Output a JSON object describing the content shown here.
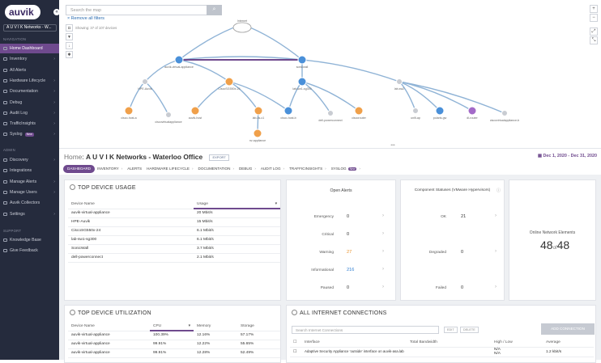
{
  "brand": {
    "logo_text": "auvik",
    "collapse_icon": "«"
  },
  "org_selector": "A U V I K Networks - W...",
  "sidebar": {
    "navigation_label": "NAVIGATION",
    "nav_items": [
      {
        "label": "Home Dashboard",
        "active": true
      },
      {
        "label": "Inventory",
        "chevron": "›"
      },
      {
        "label": "All Alerts"
      },
      {
        "label": "Hardware Lifecycle",
        "chevron": "›"
      },
      {
        "label": "Documentation",
        "chevron": "›"
      },
      {
        "label": "Debug",
        "chevron": "›"
      },
      {
        "label": "Audit Log",
        "chevron": "›"
      },
      {
        "label": "TrafficInsights",
        "chevron": "›"
      },
      {
        "label": "Syslog",
        "badge": "New",
        "chevron": "›"
      }
    ],
    "admin_label": "ADMIN",
    "admin_items": [
      {
        "label": "Discovery",
        "chevron": "›"
      },
      {
        "label": "Integrations"
      },
      {
        "label": "Manage Alerts",
        "chevron": "›"
      },
      {
        "label": "Manage Users",
        "chevron": "›"
      },
      {
        "label": "Auvik Collectors"
      },
      {
        "label": "Settings",
        "chevron": "›"
      }
    ],
    "support_label": "SUPPORT",
    "support_items": [
      {
        "label": "Knowledge Base"
      },
      {
        "label": "Give Feedback"
      }
    ]
  },
  "map": {
    "search_placeholder": "Search the map",
    "remove_filters": "Remove all filters",
    "showing": "Showing: 37 of 107 devices",
    "nodes": [
      "Internet",
      "sonicwall",
      "auvik-virtual-appliance",
      "HPE-Auvik",
      "CiscoSG550x-24",
      "lab-sw1-sg300",
      "cisco-host-a",
      "ciscovirtualappliance",
      "auvik-host",
      "lab-ks-c1",
      "cisco-host-b",
      "dell-powerconnect",
      "ciscorouter",
      "lab-sw2",
      "unifi-ap",
      "polaris-gw",
      "dl-router",
      "ciscovirtualappliance-b",
      "nv-appliance"
    ]
  },
  "header": {
    "home": "Home",
    "title": "A U V I K Networks - Waterloo Office",
    "export": "EXPORT",
    "date_range": "Dec 1, 2020 - Dec 31, 2020",
    "tabs": [
      {
        "label": "DASHBOARD",
        "active": true
      },
      {
        "label": "INVENTORY",
        "chevron": "›"
      },
      {
        "label": "ALERTS"
      },
      {
        "label": "HARDWARE LIFECYCLE",
        "chevron": "›"
      },
      {
        "label": "DOCUMENTATION",
        "chevron": "›"
      },
      {
        "label": "DEBUG",
        "chevron": "›"
      },
      {
        "label": "AUDIT LOG",
        "chevron": "›"
      },
      {
        "label": "TRAFFICINSIGHTS",
        "chevron": "›"
      },
      {
        "label": "SYSLOG",
        "badge": "New",
        "chevron": "›"
      }
    ]
  },
  "top_usage": {
    "title": "TOP DEVICE USAGE",
    "columns": [
      "Device Name",
      "Usage"
    ],
    "rows": [
      [
        "auvik-virtual-appliance",
        "20 Mbit/s"
      ],
      [
        "HPE-Auvik",
        "15 Mbit/s"
      ],
      [
        "CiscoSG550x-24",
        "6.1 Mbit/s"
      ],
      [
        "lab-sw1-sg300",
        "6.1 Mbit/s"
      ],
      [
        "SonicWall",
        "3.7 Mbit/s"
      ],
      [
        "dell-powerconnect",
        "2.1 Mbit/s"
      ]
    ]
  },
  "open_alerts": {
    "title": "Open Alerts",
    "rows": [
      {
        "label": "Emergency",
        "value": "0"
      },
      {
        "label": "Critical",
        "value": "0"
      },
      {
        "label": "Warning",
        "value": "27",
        "color": "#e8922b"
      },
      {
        "label": "Informational",
        "value": "216",
        "color": "#2b7bd0"
      },
      {
        "label": "Paused",
        "value": "0"
      }
    ]
  },
  "component_statuses": {
    "title": "Component Statuses (VMware Hypervisors)",
    "rows": [
      {
        "label": "OK",
        "value": "21"
      },
      {
        "label": "Degraded",
        "value": "0"
      },
      {
        "label": "Failed",
        "value": "0"
      }
    ]
  },
  "online_elements": {
    "title": "Online Network Elements",
    "online": "48",
    "of": "of",
    "total": "48"
  },
  "top_utilization": {
    "title": "TOP DEVICE UTILIZATION",
    "columns": [
      "Device Name",
      "CPU",
      "Memory",
      "Storage"
    ],
    "rows": [
      [
        "auvik-virtual-appliance",
        "100.39%",
        "12.16%",
        "57.17%"
      ],
      [
        "auvik-virtual-appliance",
        "99.91%",
        "12.22%",
        "55.65%"
      ],
      [
        "auvik-virtual-appliance",
        "99.91%",
        "12.28%",
        "52.49%"
      ]
    ]
  },
  "internet_connections": {
    "title": "ALL INTERNET CONNECTIONS",
    "search_placeholder": "Search Internet Connections",
    "edit": "EDIT",
    "delete": "DELETE",
    "add": "ADD CONNECTION",
    "columns": [
      "Interface",
      "Total Bandwidth",
      "High / Low",
      "Average"
    ],
    "rows": [
      {
        "interface": "Adaptive Security Appliance 'outside' interface on auvik-asa.lab",
        "bandwidth": "",
        "high": "N/A",
        "low": "N/A",
        "average": "1.2 kbit/s"
      }
    ]
  },
  "colors": {
    "accent": "#6f4a8e",
    "sidebar": "#252b3d",
    "map_link": "#8fb3d6",
    "node_orange": "#f0a04a",
    "node_blue": "#4a90d9",
    "node_gray": "#c9ccd2"
  }
}
